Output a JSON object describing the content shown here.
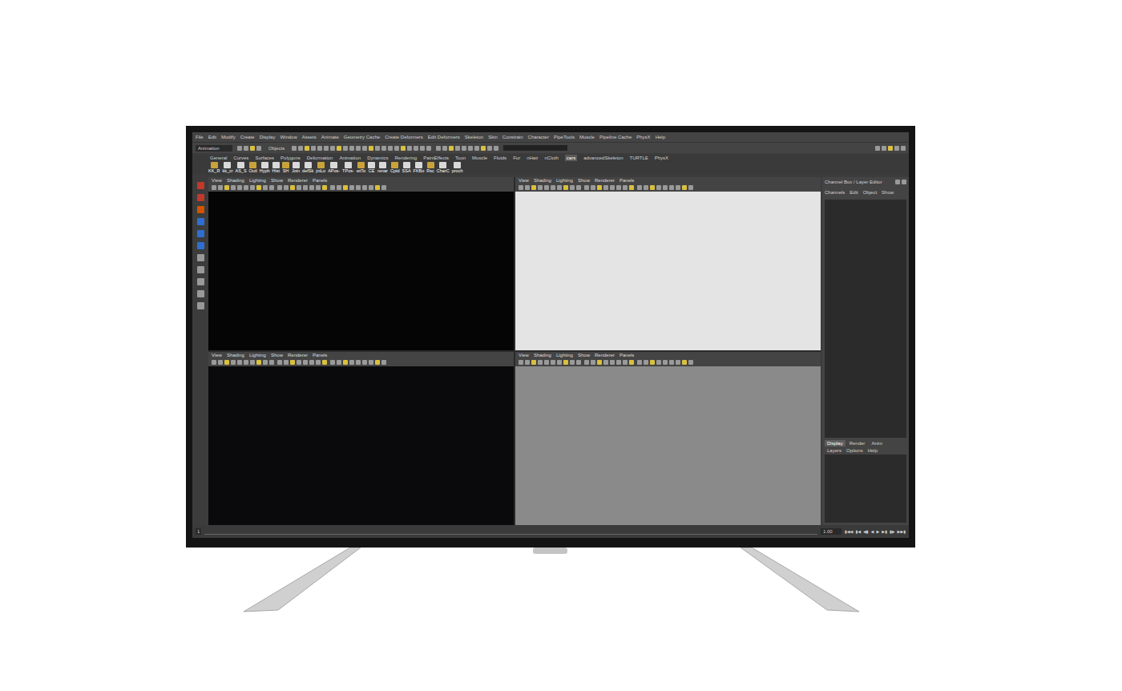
{
  "menu_bar": [
    "File",
    "Edit",
    "Modify",
    "Create",
    "Display",
    "Window",
    "Assets",
    "Animate",
    "Geometry Cache",
    "Create Deformers",
    "Edit Deformers",
    "Skeleton",
    "Skin",
    "Constrain",
    "Character",
    "PipeTools",
    "Muscle",
    "Pipeline Cache",
    "PhysX",
    "Help"
  ],
  "status_line": {
    "mode": "Animation",
    "selection_mode": "Objects"
  },
  "shelf_tabs": [
    {
      "label": "General",
      "selected": false
    },
    {
      "label": "Curves",
      "selected": false
    },
    {
      "label": "Surfaces",
      "selected": false
    },
    {
      "label": "Polygons",
      "selected": false
    },
    {
      "label": "Deformation",
      "selected": false
    },
    {
      "label": "Animation",
      "selected": false
    },
    {
      "label": "Dynamics",
      "selected": false
    },
    {
      "label": "Rendering",
      "selected": false
    },
    {
      "label": "PaintEffects",
      "selected": false
    },
    {
      "label": "Toon",
      "selected": false
    },
    {
      "label": "Muscle",
      "selected": false
    },
    {
      "label": "Fluids",
      "selected": false
    },
    {
      "label": "Fur",
      "selected": false
    },
    {
      "label": "nHair",
      "selected": false
    },
    {
      "label": "nCloth",
      "selected": false
    },
    {
      "label": "cars",
      "selected": true
    },
    {
      "label": "advancedSkeleton",
      "selected": false
    },
    {
      "label": "TURTLE",
      "selected": false
    },
    {
      "label": "PhysX",
      "selected": false
    }
  ],
  "shelf_buttons": [
    "KK_R",
    "kk_cr",
    "AS_S",
    "Outl",
    "Hyph",
    "Hist",
    "SH",
    "Join",
    "defSk",
    "jntLo",
    "APos-",
    "TPos-",
    "wtTo",
    "CE",
    "renar",
    "Cptd",
    "SSA",
    "FKBo",
    "Rsc",
    "CharC",
    "proch"
  ],
  "viewports": [
    {
      "menu": [
        "View",
        "Shading",
        "Lighting",
        "Show",
        "Renderer",
        "Panels"
      ],
      "color": "#050505"
    },
    {
      "menu": [
        "View",
        "Shading",
        "Lighting",
        "Show",
        "Renderer",
        "Panels"
      ],
      "color": "#e4e4e4"
    },
    {
      "menu": [
        "View",
        "Shading",
        "Lighting",
        "Show",
        "Renderer",
        "Panels"
      ],
      "color": "#0a0a0c"
    },
    {
      "menu": [
        "View",
        "Shading",
        "Lighting",
        "Show",
        "Renderer",
        "Panels"
      ],
      "color": "#8a8a8a"
    }
  ],
  "channel_box": {
    "title": "Channel Box / Layer Editor",
    "menu": [
      "Channels",
      "Edit",
      "Object",
      "Show"
    ]
  },
  "layer_editor": {
    "tabs": [
      {
        "label": "Display",
        "selected": true
      },
      {
        "label": "Render",
        "selected": false
      },
      {
        "label": "Anim",
        "selected": false
      }
    ],
    "menu": [
      "Layers",
      "Options",
      "Help"
    ]
  },
  "timeline": {
    "start": "1",
    "current": "1.00",
    "controls": [
      "▮◀◀",
      "▮◀",
      "◀▮",
      "◀",
      "▶",
      "▶▮",
      "▮▶",
      "▶▶▮"
    ]
  }
}
